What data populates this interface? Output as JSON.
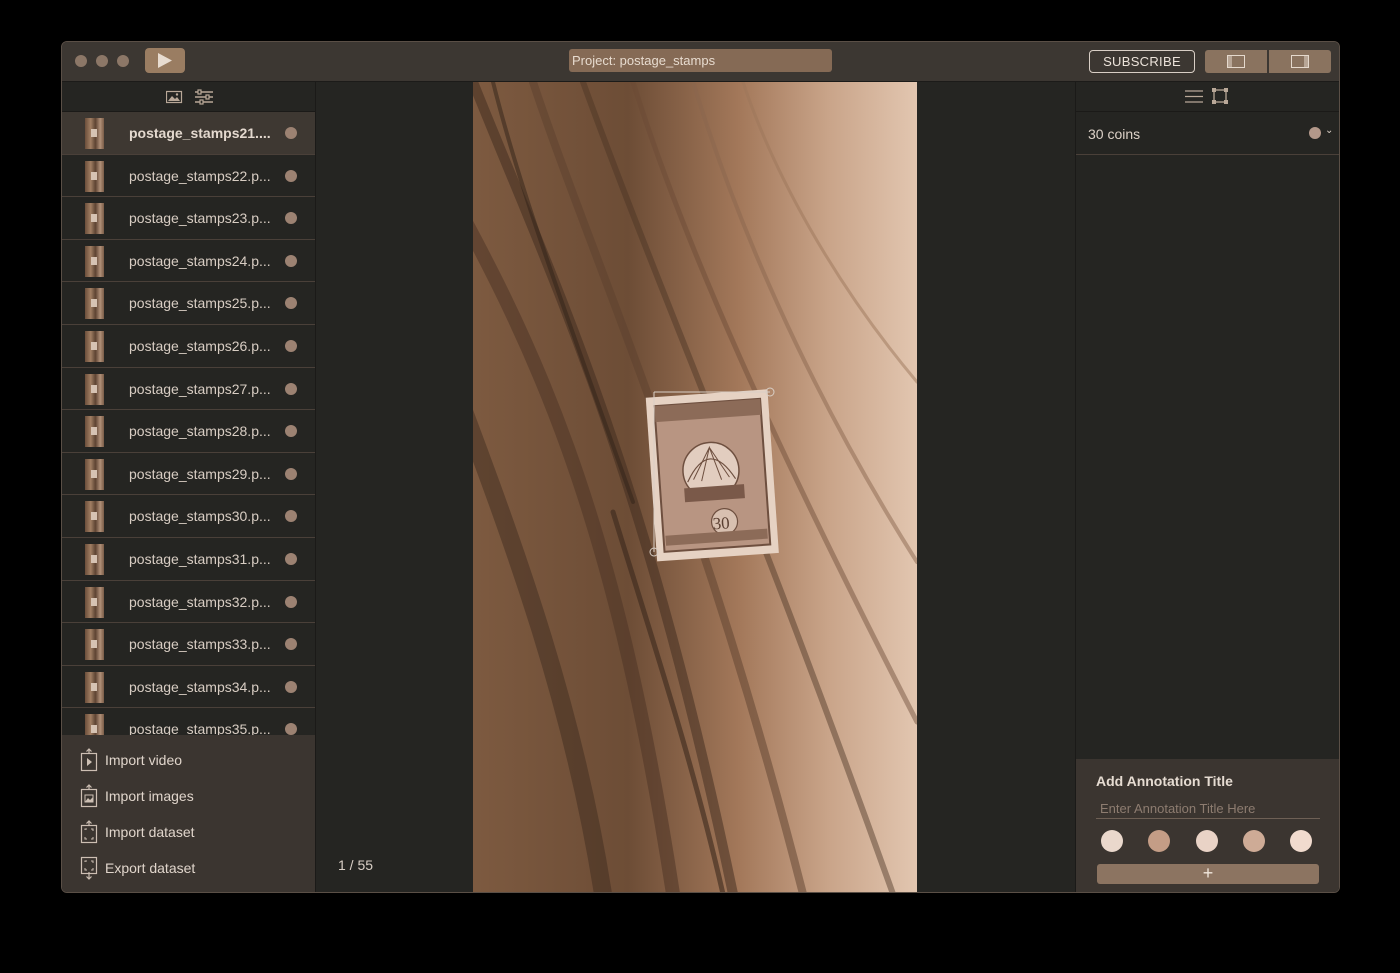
{
  "window": {
    "project_title": "Project: postage_stamps",
    "subscribe_label": "SUBSCRIBE"
  },
  "sidebar": {
    "files": [
      {
        "name": "postage_stamps21....",
        "selected": true
      },
      {
        "name": "postage_stamps22.p..."
      },
      {
        "name": "postage_stamps23.p..."
      },
      {
        "name": "postage_stamps24.p..."
      },
      {
        "name": "postage_stamps25.p..."
      },
      {
        "name": "postage_stamps26.p..."
      },
      {
        "name": "postage_stamps27.p..."
      },
      {
        "name": "postage_stamps28.p..."
      },
      {
        "name": "postage_stamps29.p..."
      },
      {
        "name": "postage_stamps30.p..."
      },
      {
        "name": "postage_stamps31.p..."
      },
      {
        "name": "postage_stamps32.p..."
      },
      {
        "name": "postage_stamps33.p..."
      },
      {
        "name": "postage_stamps34.p..."
      },
      {
        "name": "postage_stamps35.p..."
      }
    ],
    "actions": {
      "import_video": "Import video",
      "import_images": "Import images",
      "import_dataset": "Import dataset",
      "export_dataset": "Export dataset"
    }
  },
  "canvas": {
    "page_counter": "1 / 55",
    "stamp_value": "30"
  },
  "annotations": {
    "items": [
      {
        "label": "30 coins",
        "color": "#b3988a"
      }
    ]
  },
  "add_annotation": {
    "title": "Add Annotation Title",
    "placeholder": "Enter Annotation Title Here",
    "swatches": [
      "#ead8cc",
      "#c49d86",
      "#e9d3c6",
      "#ceab96",
      "#f1dbce"
    ],
    "add_label": "+"
  },
  "colors": {
    "accent": "#9a7d62",
    "panel": "#3b3530",
    "background": "#252522"
  }
}
